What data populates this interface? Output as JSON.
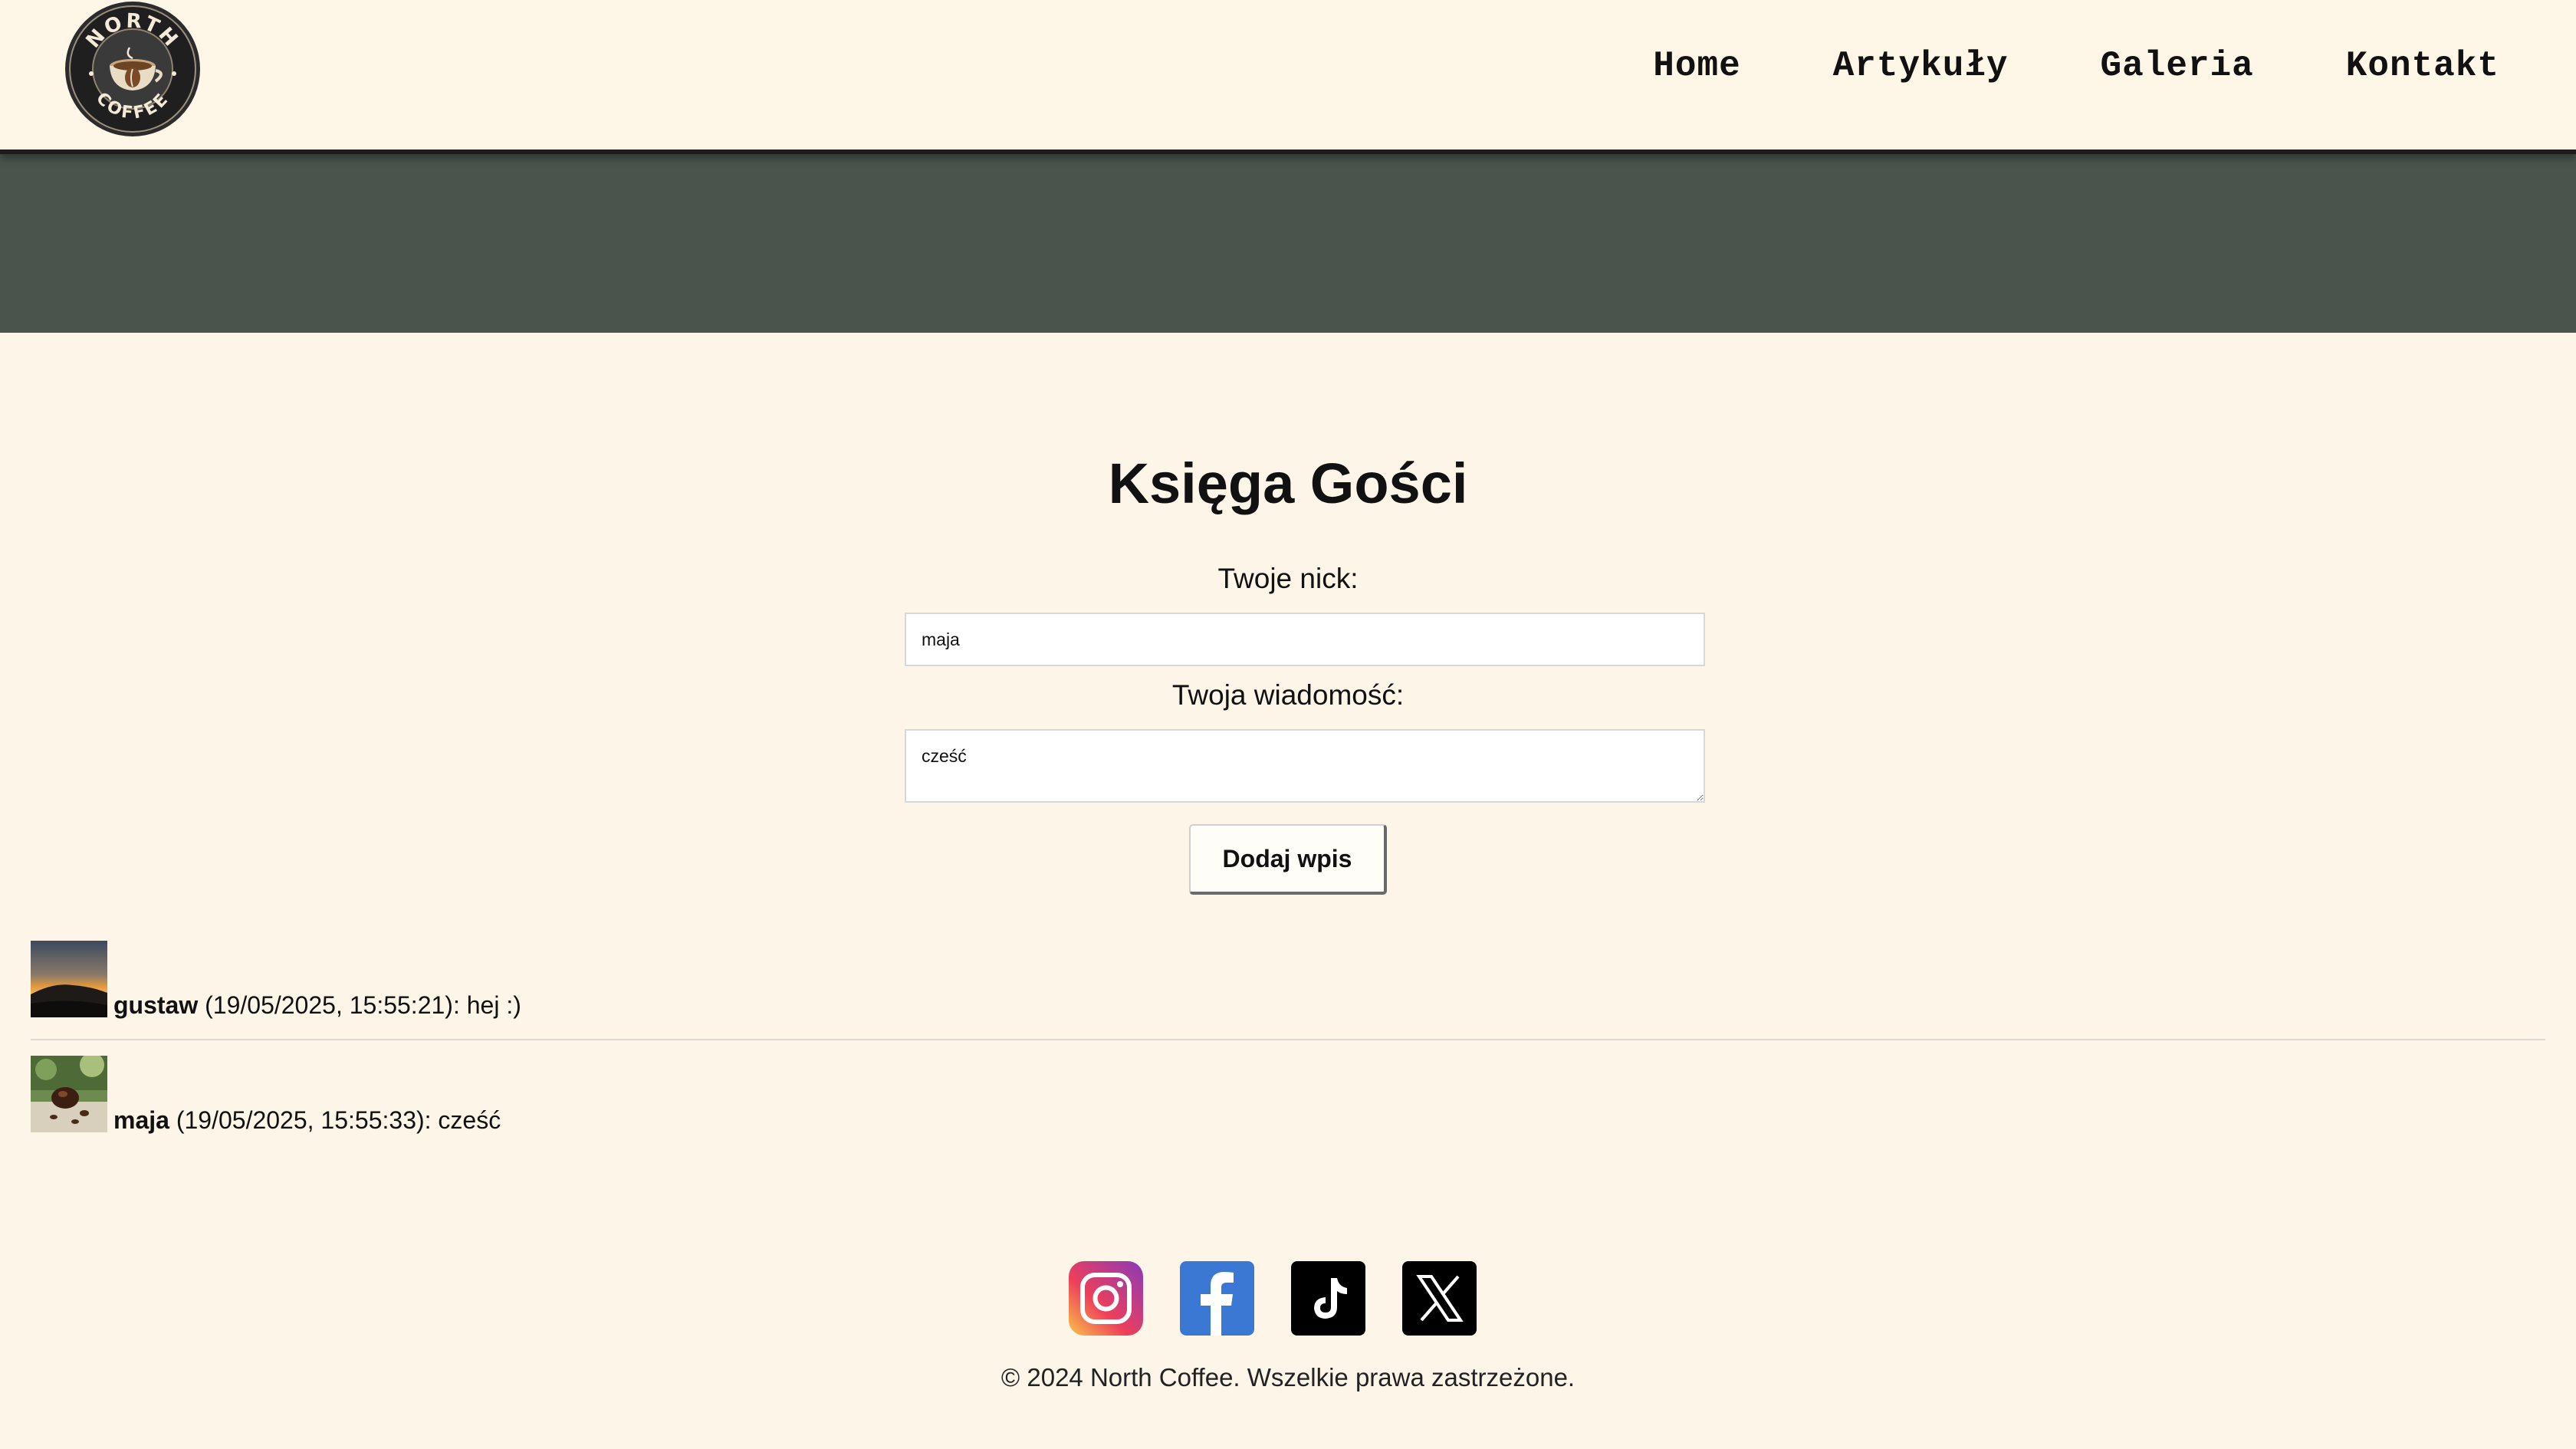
{
  "header": {
    "logo_top_text": "NORTH",
    "logo_bottom_text": "COFFEE",
    "nav": [
      {
        "label": "Home"
      },
      {
        "label": "Artykuły"
      },
      {
        "label": "Galeria"
      },
      {
        "label": "Kontakt"
      }
    ]
  },
  "guestbook": {
    "title": "Księga Gości",
    "nick_label": "Twoje nick:",
    "nick_value": "maja",
    "message_label": "Twoja wiadomość:",
    "message_value": "cześć",
    "submit_label": "Dodaj wpis",
    "entries": [
      {
        "nick": "gustaw",
        "meta": " (19/05/2025, 15:55:21): hej :)",
        "avatar": "sunset-mountain-image"
      },
      {
        "nick": "maja",
        "meta": " (19/05/2025, 15:55:33): cześć",
        "avatar": "coffee-beans-image"
      }
    ]
  },
  "footer": {
    "socials": [
      {
        "name": "instagram-icon"
      },
      {
        "name": "facebook-icon"
      },
      {
        "name": "tiktok-icon"
      },
      {
        "name": "x-icon"
      }
    ],
    "copyright": "© 2024 North Coffee. Wszelkie prawa zastrzeżone."
  },
  "colors": {
    "page_bg": "#fdf5e8",
    "header_bg": "#fef6e6",
    "hero_bg": "#4b544c",
    "text": "#111111"
  }
}
